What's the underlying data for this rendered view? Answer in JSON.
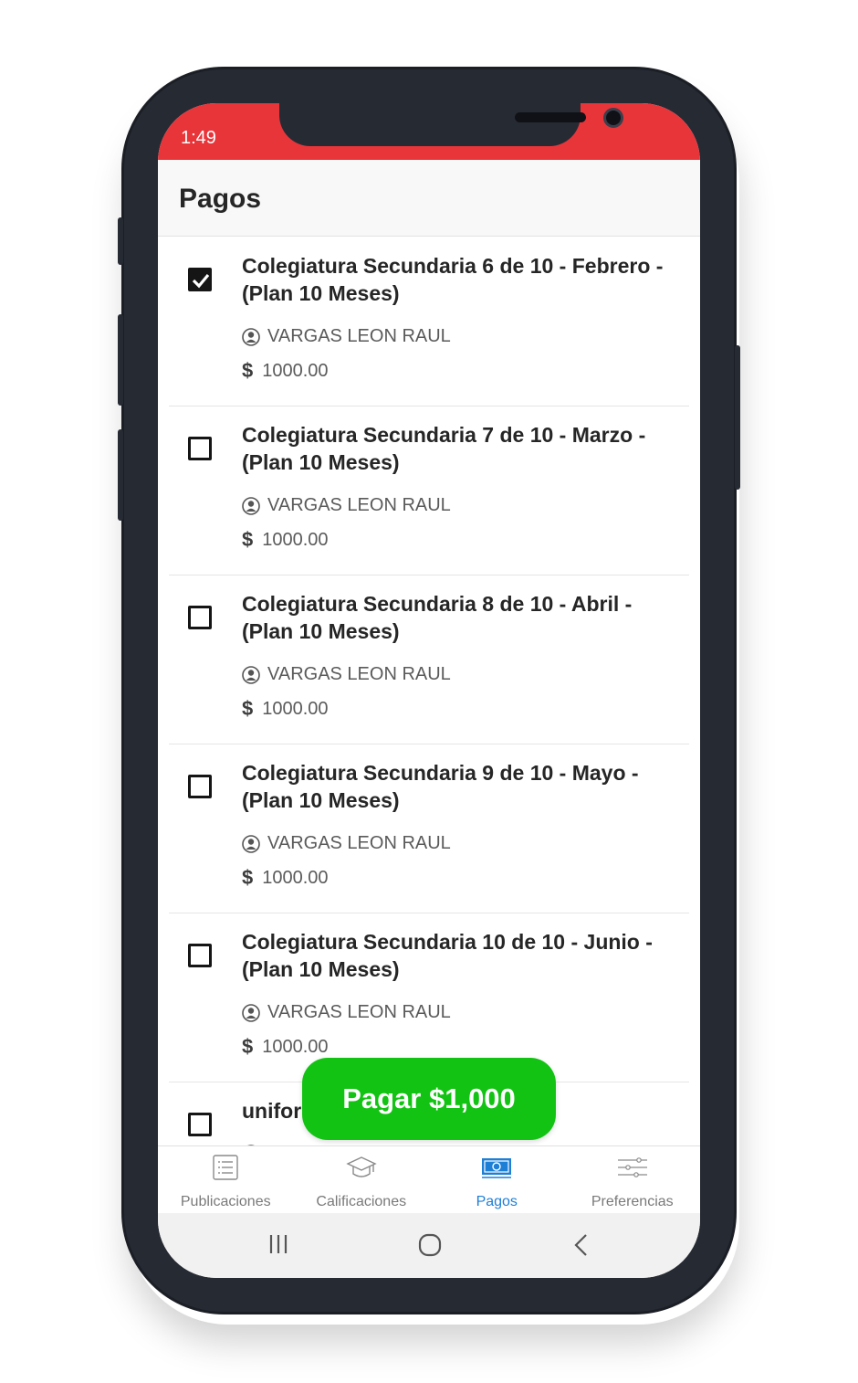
{
  "status_bar": {
    "time": "1:49",
    "color": "#e8353a"
  },
  "header": {
    "title": "Pagos"
  },
  "payments": [
    {
      "title": "Colegiatura Secundaria 6 de 10 - Febrero - (Plan 10 Meses)",
      "student": "VARGAS LEON RAUL",
      "amount": "1000.00",
      "checked": true
    },
    {
      "title": "Colegiatura Secundaria 7 de 10 - Marzo - (Plan 10 Meses)",
      "student": "VARGAS LEON RAUL",
      "amount": "1000.00",
      "checked": false
    },
    {
      "title": "Colegiatura Secundaria 8 de 10 - Abril - (Plan 10 Meses)",
      "student": "VARGAS LEON RAUL",
      "amount": "1000.00",
      "checked": false
    },
    {
      "title": "Colegiatura Secundaria 9 de 10 - Mayo - (Plan 10 Meses)",
      "student": "VARGAS LEON RAUL",
      "amount": "1000.00",
      "checked": false
    },
    {
      "title": "Colegiatura Secundaria 10 de 10 - Junio - (Plan 10 Meses)",
      "student": "VARGAS LEON RAUL",
      "amount": "1000.00",
      "checked": false
    },
    {
      "title": "unifor",
      "student": "",
      "amount": "",
      "checked": false
    }
  ],
  "currency_symbol": "$",
  "pay_button": {
    "label": "Pagar $1,000",
    "color": "#13c313"
  },
  "tabs": [
    {
      "label": "Publicaciones",
      "icon": "list-icon",
      "active": false
    },
    {
      "label": "Calificaciones",
      "icon": "graduation-cap-icon",
      "active": false
    },
    {
      "label": "Pagos",
      "icon": "money-icon",
      "active": true
    },
    {
      "label": "Preferencias",
      "icon": "sliders-icon",
      "active": false
    }
  ],
  "accent_color": "#1e7fd6",
  "system_nav": [
    "recents-button",
    "home-button",
    "back-button"
  ]
}
